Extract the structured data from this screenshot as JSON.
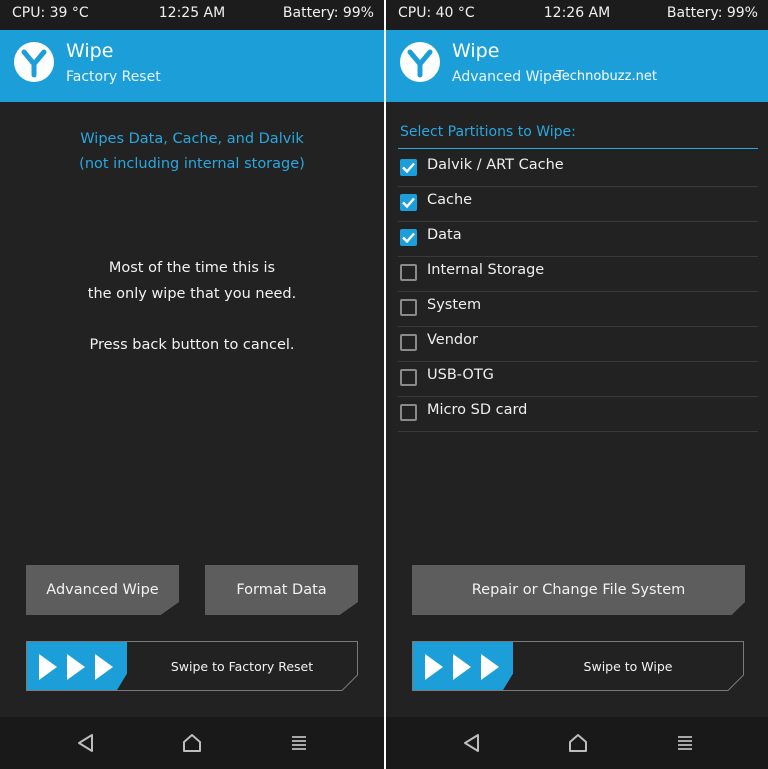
{
  "left": {
    "status": {
      "cpu": "CPU: 39 °C",
      "time": "12:25 AM",
      "battery": "Battery: 99%"
    },
    "header": {
      "title": "Wipe",
      "subtitle": "Factory Reset"
    },
    "info_line1": "Wipes Data, Cache, and Dalvik",
    "info_line2": "(not including internal storage)",
    "message_line1": "Most of the time this is",
    "message_line2": "the only wipe that you need.",
    "message_line3": "Press back button to cancel.",
    "buttons": {
      "advanced_wipe": "Advanced Wipe",
      "format_data": "Format Data"
    },
    "swipe_label": "Swipe to Factory Reset"
  },
  "right": {
    "status": {
      "cpu": "CPU: 40 °C",
      "time": "12:26 AM",
      "battery": "Battery: 99%"
    },
    "header": {
      "title": "Wipe",
      "subtitle": "Advanced Wipe",
      "watermark": "Technobuzz.net"
    },
    "partitions_title": "Select Partitions to Wipe:",
    "partitions": [
      {
        "label": "Dalvik / ART Cache",
        "checked": true
      },
      {
        "label": "Cache",
        "checked": true
      },
      {
        "label": "Data",
        "checked": true
      },
      {
        "label": "Internal Storage",
        "checked": false
      },
      {
        "label": "System",
        "checked": false
      },
      {
        "label": "Vendor",
        "checked": false
      },
      {
        "label": "USB-OTG",
        "checked": false
      },
      {
        "label": "Micro SD card",
        "checked": false
      }
    ],
    "repair_button": "Repair or Change File System",
    "swipe_label": "Swipe to Wipe"
  },
  "colors": {
    "accent": "#1c9fd8",
    "background": "#222222",
    "button": "#5d5d5d",
    "accent_text": "#2aa7de"
  },
  "icons": {
    "logo": "twrp-logo-icon",
    "back": "back-triangle-icon",
    "home": "home-icon",
    "menu": "menu-lines-icon",
    "swipe": "chevron-right-icon"
  }
}
